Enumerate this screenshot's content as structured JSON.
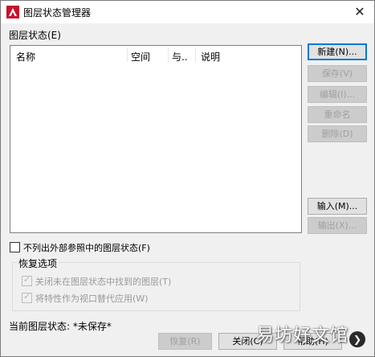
{
  "dialog": {
    "title": "图层状态管理器",
    "close_glyph": "✕"
  },
  "list": {
    "section_label": "图层状态(E)",
    "columns": [
      "名称",
      "空间",
      "与..",
      "说明"
    ]
  },
  "buttons": {
    "new": "新建(N)...",
    "save": "保存(V)",
    "edit": "编辑(I)...",
    "rename": "重命名",
    "delete": "删除(D)",
    "import": "输入(M)...",
    "export": "输出(X)...",
    "restore": "恢复(R)",
    "close": "关闭(C)",
    "help": "帮助(H)"
  },
  "options": {
    "exclude_xref_label": "不列出外部参照中的图层状态(F)",
    "exclude_xref_checked": false,
    "restore_group_title": "恢复选项",
    "turn_off_label": "关闭未在图层状态中找到的图层(T)",
    "turn_off_checked": true,
    "viewport_label": "将特性作为视口替代应用(W)",
    "viewport_checked": true
  },
  "status": {
    "current_label": "当前图层状态: *未保存*"
  },
  "watermark": {
    "text": "易坊好文馆",
    "badge": "❯"
  },
  "colors": {
    "accent": "#0078d7",
    "brand_red": "#c8102e"
  },
  "icons": {
    "app": "autocad-logo-icon",
    "close": "close-icon",
    "check": "checkmark-icon"
  }
}
